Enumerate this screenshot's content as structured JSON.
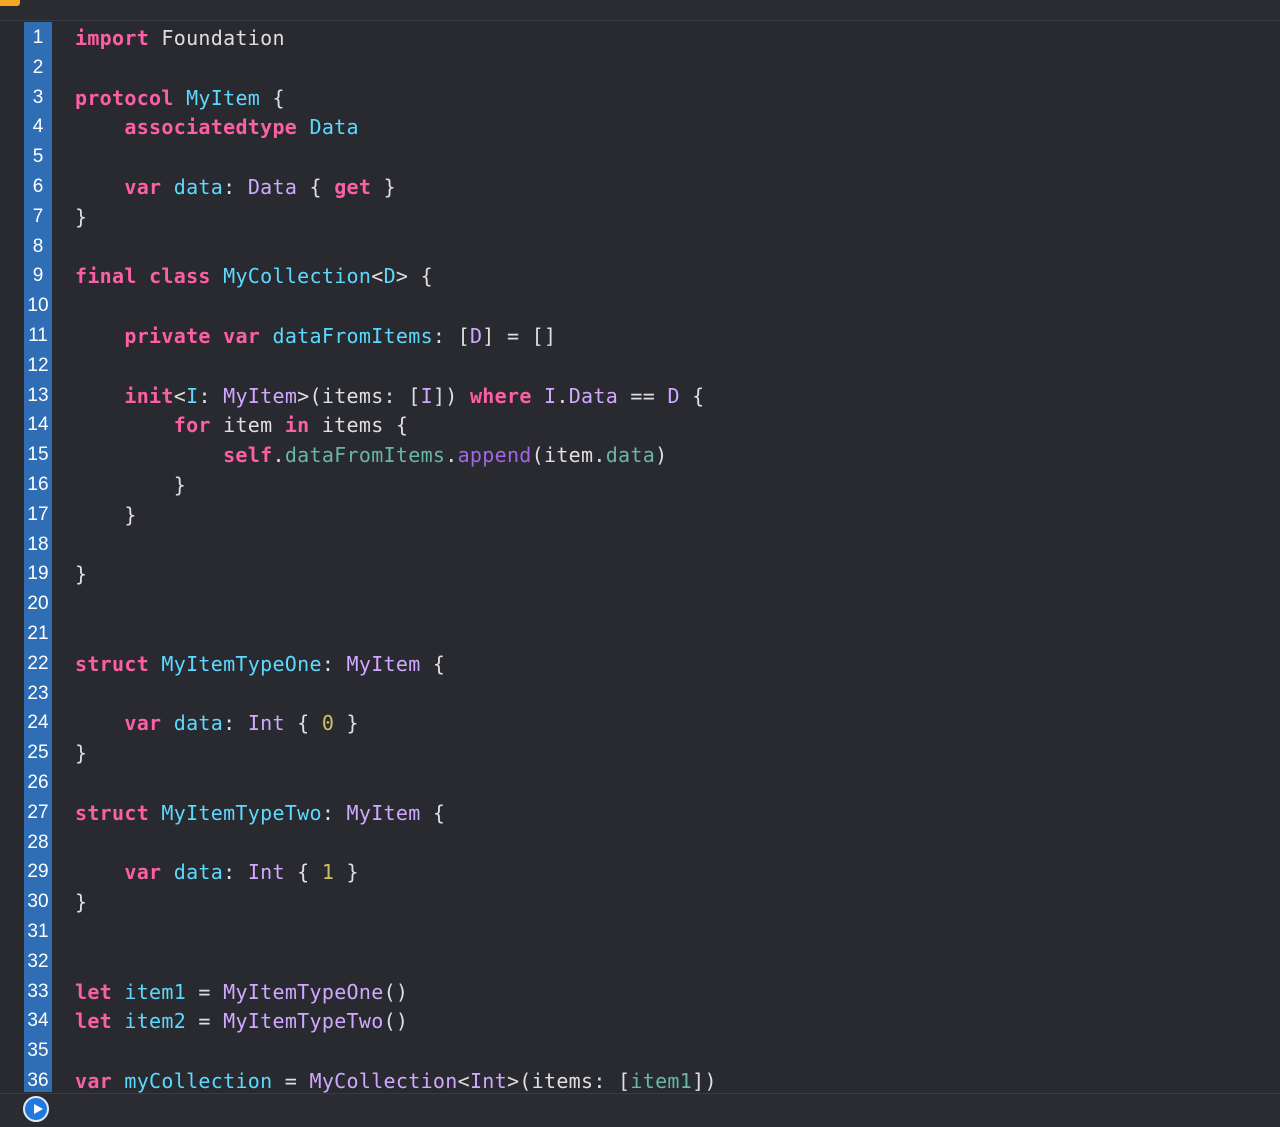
{
  "editor": {
    "lines": [
      {
        "n": "1",
        "tokens": [
          {
            "t": "import",
            "c": "kw"
          },
          {
            "t": " Foundation",
            "c": ""
          }
        ]
      },
      {
        "n": "2",
        "tokens": []
      },
      {
        "n": "3",
        "tokens": [
          {
            "t": "protocol",
            "c": "kw"
          },
          {
            "t": " ",
            "c": ""
          },
          {
            "t": "MyItem",
            "c": "ty"
          },
          {
            "t": " {",
            "c": ""
          }
        ]
      },
      {
        "n": "4",
        "tokens": [
          {
            "t": "    ",
            "c": ""
          },
          {
            "t": "associatedtype",
            "c": "kw"
          },
          {
            "t": " ",
            "c": ""
          },
          {
            "t": "Data",
            "c": "ty"
          }
        ]
      },
      {
        "n": "5",
        "tokens": []
      },
      {
        "n": "6",
        "tokens": [
          {
            "t": "    ",
            "c": ""
          },
          {
            "t": "var",
            "c": "kw"
          },
          {
            "t": " ",
            "c": ""
          },
          {
            "t": "data",
            "c": "ty"
          },
          {
            "t": ": ",
            "c": ""
          },
          {
            "t": "Data",
            "c": "sy"
          },
          {
            "t": " { ",
            "c": ""
          },
          {
            "t": "get",
            "c": "kw"
          },
          {
            "t": " }",
            "c": ""
          }
        ]
      },
      {
        "n": "7",
        "tokens": [
          {
            "t": "}",
            "c": ""
          }
        ]
      },
      {
        "n": "8",
        "tokens": []
      },
      {
        "n": "9",
        "tokens": [
          {
            "t": "final",
            "c": "kw"
          },
          {
            "t": " ",
            "c": ""
          },
          {
            "t": "class",
            "c": "kw"
          },
          {
            "t": " ",
            "c": ""
          },
          {
            "t": "MyCollection",
            "c": "ty"
          },
          {
            "t": "<",
            "c": ""
          },
          {
            "t": "D",
            "c": "ty"
          },
          {
            "t": "> {",
            "c": ""
          }
        ]
      },
      {
        "n": "10",
        "tokens": []
      },
      {
        "n": "11",
        "tokens": [
          {
            "t": "    ",
            "c": ""
          },
          {
            "t": "private",
            "c": "kw"
          },
          {
            "t": " ",
            "c": ""
          },
          {
            "t": "var",
            "c": "kw"
          },
          {
            "t": " ",
            "c": ""
          },
          {
            "t": "dataFromItems",
            "c": "ty"
          },
          {
            "t": ": [",
            "c": ""
          },
          {
            "t": "D",
            "c": "sy"
          },
          {
            "t": "] = []",
            "c": ""
          }
        ]
      },
      {
        "n": "12",
        "tokens": []
      },
      {
        "n": "13",
        "tokens": [
          {
            "t": "    ",
            "c": ""
          },
          {
            "t": "init",
            "c": "kw"
          },
          {
            "t": "<",
            "c": ""
          },
          {
            "t": "I",
            "c": "ty"
          },
          {
            "t": ": ",
            "c": ""
          },
          {
            "t": "MyItem",
            "c": "sy"
          },
          {
            "t": ">(items: [",
            "c": ""
          },
          {
            "t": "I",
            "c": "sy"
          },
          {
            "t": "]) ",
            "c": ""
          },
          {
            "t": "where",
            "c": "kw"
          },
          {
            "t": " ",
            "c": ""
          },
          {
            "t": "I",
            "c": "sy"
          },
          {
            "t": ".",
            "c": ""
          },
          {
            "t": "Data",
            "c": "sy"
          },
          {
            "t": " == ",
            "c": ""
          },
          {
            "t": "D",
            "c": "sy"
          },
          {
            "t": " {",
            "c": ""
          }
        ]
      },
      {
        "n": "14",
        "tokens": [
          {
            "t": "        ",
            "c": ""
          },
          {
            "t": "for",
            "c": "kw"
          },
          {
            "t": " item ",
            "c": ""
          },
          {
            "t": "in",
            "c": "kw"
          },
          {
            "t": " items {",
            "c": ""
          }
        ]
      },
      {
        "n": "15",
        "tokens": [
          {
            "t": "            ",
            "c": ""
          },
          {
            "t": "self",
            "c": "kw"
          },
          {
            "t": ".",
            "c": ""
          },
          {
            "t": "dataFromItems",
            "c": "pr"
          },
          {
            "t": ".",
            "c": ""
          },
          {
            "t": "append",
            "c": "md"
          },
          {
            "t": "(item.",
            "c": ""
          },
          {
            "t": "data",
            "c": "pr"
          },
          {
            "t": ")",
            "c": ""
          }
        ]
      },
      {
        "n": "16",
        "tokens": [
          {
            "t": "        }",
            "c": ""
          }
        ]
      },
      {
        "n": "17",
        "tokens": [
          {
            "t": "    }",
            "c": ""
          }
        ]
      },
      {
        "n": "18",
        "tokens": []
      },
      {
        "n": "19",
        "tokens": [
          {
            "t": "}",
            "c": ""
          }
        ]
      },
      {
        "n": "20",
        "tokens": []
      },
      {
        "n": "21",
        "tokens": []
      },
      {
        "n": "22",
        "tokens": [
          {
            "t": "struct",
            "c": "kw"
          },
          {
            "t": " ",
            "c": ""
          },
          {
            "t": "MyItemTypeOne",
            "c": "ty"
          },
          {
            "t": ": ",
            "c": ""
          },
          {
            "t": "MyItem",
            "c": "sy"
          },
          {
            "t": " {",
            "c": ""
          }
        ]
      },
      {
        "n": "23",
        "tokens": []
      },
      {
        "n": "24",
        "tokens": [
          {
            "t": "    ",
            "c": ""
          },
          {
            "t": "var",
            "c": "kw"
          },
          {
            "t": " ",
            "c": ""
          },
          {
            "t": "data",
            "c": "ty"
          },
          {
            "t": ": ",
            "c": ""
          },
          {
            "t": "Int",
            "c": "sy"
          },
          {
            "t": " { ",
            "c": ""
          },
          {
            "t": "0",
            "c": "nu"
          },
          {
            "t": " }",
            "c": ""
          }
        ]
      },
      {
        "n": "25",
        "tokens": [
          {
            "t": "}",
            "c": ""
          }
        ]
      },
      {
        "n": "26",
        "tokens": []
      },
      {
        "n": "27",
        "tokens": [
          {
            "t": "struct",
            "c": "kw"
          },
          {
            "t": " ",
            "c": ""
          },
          {
            "t": "MyItemTypeTwo",
            "c": "ty"
          },
          {
            "t": ": ",
            "c": ""
          },
          {
            "t": "MyItem",
            "c": "sy"
          },
          {
            "t": " {",
            "c": ""
          }
        ]
      },
      {
        "n": "28",
        "tokens": []
      },
      {
        "n": "29",
        "tokens": [
          {
            "t": "    ",
            "c": ""
          },
          {
            "t": "var",
            "c": "kw"
          },
          {
            "t": " ",
            "c": ""
          },
          {
            "t": "data",
            "c": "ty"
          },
          {
            "t": ": ",
            "c": ""
          },
          {
            "t": "Int",
            "c": "sy"
          },
          {
            "t": " { ",
            "c": ""
          },
          {
            "t": "1",
            "c": "nu"
          },
          {
            "t": " }",
            "c": ""
          }
        ]
      },
      {
        "n": "30",
        "tokens": [
          {
            "t": "}",
            "c": ""
          }
        ]
      },
      {
        "n": "31",
        "tokens": []
      },
      {
        "n": "32",
        "tokens": []
      },
      {
        "n": "33",
        "tokens": [
          {
            "t": "let",
            "c": "kw"
          },
          {
            "t": " ",
            "c": ""
          },
          {
            "t": "item1",
            "c": "ty"
          },
          {
            "t": " = ",
            "c": ""
          },
          {
            "t": "MyItemTypeOne",
            "c": "sy"
          },
          {
            "t": "()",
            "c": ""
          }
        ]
      },
      {
        "n": "34",
        "tokens": [
          {
            "t": "let",
            "c": "kw"
          },
          {
            "t": " ",
            "c": ""
          },
          {
            "t": "item2",
            "c": "ty"
          },
          {
            "t": " = ",
            "c": ""
          },
          {
            "t": "MyItemTypeTwo",
            "c": "sy"
          },
          {
            "t": "()",
            "c": ""
          }
        ]
      },
      {
        "n": "35",
        "tokens": []
      },
      {
        "n": "36",
        "tokens": [
          {
            "t": "var",
            "c": "kw"
          },
          {
            "t": " ",
            "c": ""
          },
          {
            "t": "myCollection",
            "c": "ty"
          },
          {
            "t": " = ",
            "c": ""
          },
          {
            "t": "MyCollection",
            "c": "sy"
          },
          {
            "t": "<",
            "c": ""
          },
          {
            "t": "Int",
            "c": "sy"
          },
          {
            "t": ">(items: [",
            "c": ""
          },
          {
            "t": "item1",
            "c": "pr"
          },
          {
            "t": "])",
            "c": ""
          }
        ]
      }
    ]
  },
  "toolbar": {
    "run_icon": "play-circle-icon",
    "warning_icon": "warning-icon"
  },
  "colors": {
    "background": "#292a30",
    "gutter": "#2f6db5",
    "keyword": "#fc5fa3",
    "type_decl": "#5dd8ff",
    "type_ref": "#d0a8ff",
    "property": "#67b7a4",
    "number": "#d0bf69",
    "method": "#a167e6"
  }
}
